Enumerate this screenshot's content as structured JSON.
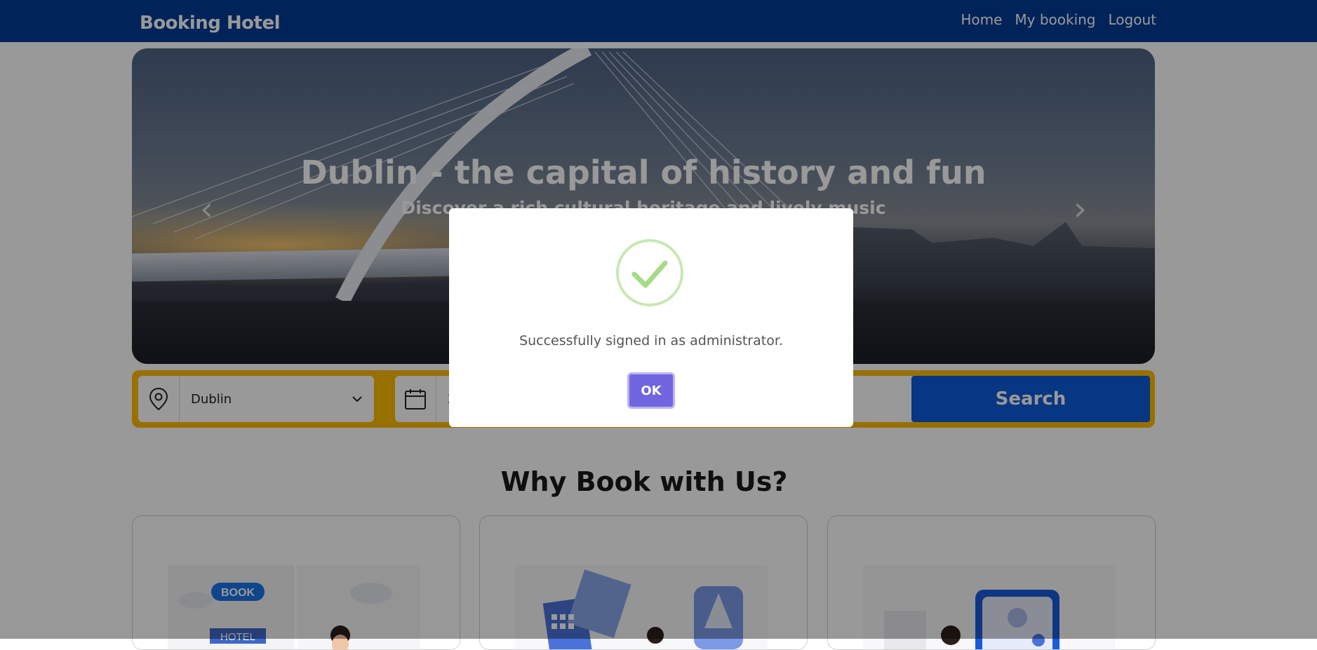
{
  "navbar": {
    "brand": "Booking Hotel",
    "links": [
      "Home",
      "My booking",
      "Logout"
    ]
  },
  "hero": {
    "title": "Dublin - the capital of history and fun",
    "subtitle": "Discover a rich cultural heritage and lively music",
    "prev_icon": "chevron-left-icon",
    "next_icon": "chevron-right-icon"
  },
  "search": {
    "location_icon": "map-pin-icon",
    "location_value": "Dublin",
    "calendar_icon": "calendar-icon",
    "date_value_partial": "2",
    "button_label": "Search"
  },
  "why": {
    "title": "Why Book with Us?",
    "card1_badge": "BOOK",
    "card1_sign": "HOTEL"
  },
  "modal": {
    "icon": "success-check-icon",
    "message": "Successfully signed in as administrator.",
    "ok_label": "OK"
  },
  "colors": {
    "navbar": "#003b95",
    "search_border": "#febb02",
    "search_button": "#0d5ad9",
    "ok_button": "#7066e0",
    "success": "#a5dc86"
  }
}
